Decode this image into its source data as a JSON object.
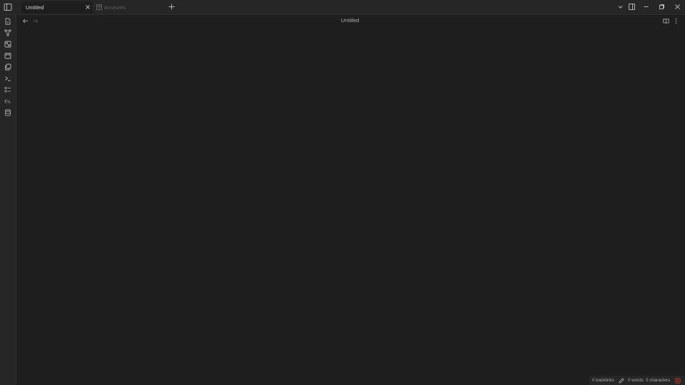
{
  "tabs": [
    {
      "label": "Untitled",
      "active": true
    },
    {
      "label": "accounts",
      "active": false
    }
  ],
  "header": {
    "title": "Untitled"
  },
  "ribbon": {
    "icons": [
      "new-note-icon",
      "graph-view-icon",
      "canvas-icon",
      "calendar-icon",
      "copy-icon",
      "terminal-icon",
      "tasks-icon",
      "templater-icon",
      "database-icon"
    ]
  },
  "status": {
    "backlinks": "0 backlinks",
    "words": "0 words",
    "characters": "0 characters"
  },
  "colors": {
    "background": "#1e1e1e",
    "chrome": "#262626",
    "sync_error": "#c0392b"
  }
}
